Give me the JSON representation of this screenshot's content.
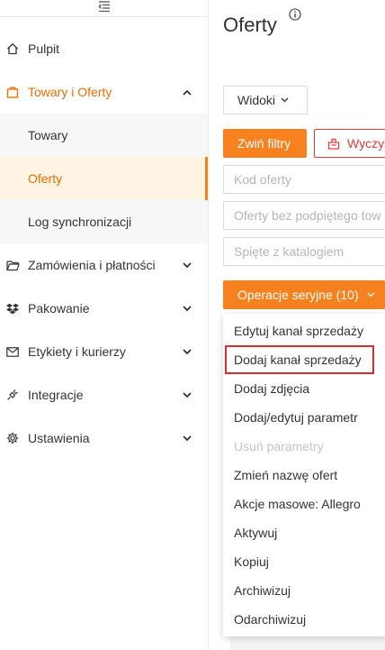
{
  "sidebar": {
    "items": [
      {
        "label": "Pulpit",
        "icon": "home-icon"
      },
      {
        "label": "Towary i Oferty",
        "icon": "bag-icon"
      },
      {
        "label": "Zamówienia i płatności",
        "icon": "folder-icon"
      },
      {
        "label": "Pakowanie",
        "icon": "dropbox-icon"
      },
      {
        "label": "Etykiety i kurierzy",
        "icon": "envelope-icon"
      },
      {
        "label": "Integracje",
        "icon": "plug-icon"
      },
      {
        "label": "Ustawienia",
        "icon": "gear-icon"
      }
    ],
    "subitems": [
      {
        "label": "Towary"
      },
      {
        "label": "Oferty"
      },
      {
        "label": "Log synchronizacji"
      }
    ]
  },
  "main": {
    "title": "Oferty",
    "views_button": "Widoki",
    "collapse_filters_button": "Zwiń filtry",
    "clear_button": "Wyczyś",
    "filters": {
      "offer_code_placeholder": "Kod oferty",
      "unlinked_placeholder": "Oferty bez podpiętego tow",
      "catalog_placeholder": "Spięte z katalogiem"
    },
    "bulk_ops_button": "Operacje seryjne (10)"
  },
  "dropdown": {
    "items": [
      {
        "label": "Edytuj kanał sprzedaży",
        "disabled": false
      },
      {
        "label": "Dodaj kanał sprzedaży",
        "disabled": false
      },
      {
        "label": "Dodaj zdjęcia",
        "disabled": false
      },
      {
        "label": "Dodaj/edytuj parametr",
        "disabled": false
      },
      {
        "label": "Usuń parametry",
        "disabled": true
      },
      {
        "label": "Zmień nazwę ofert",
        "disabled": false
      },
      {
        "label": "Akcje masowe: Allegro",
        "disabled": false
      },
      {
        "label": "Aktywuj",
        "disabled": false
      },
      {
        "label": "Kopiuj",
        "disabled": false
      },
      {
        "label": "Archiwizuj",
        "disabled": false
      },
      {
        "label": "Odarchiwizuj",
        "disabled": false
      }
    ]
  },
  "colors": {
    "accent": "#f7811f",
    "danger": "#e53935",
    "highlight": "#d32f2f"
  }
}
